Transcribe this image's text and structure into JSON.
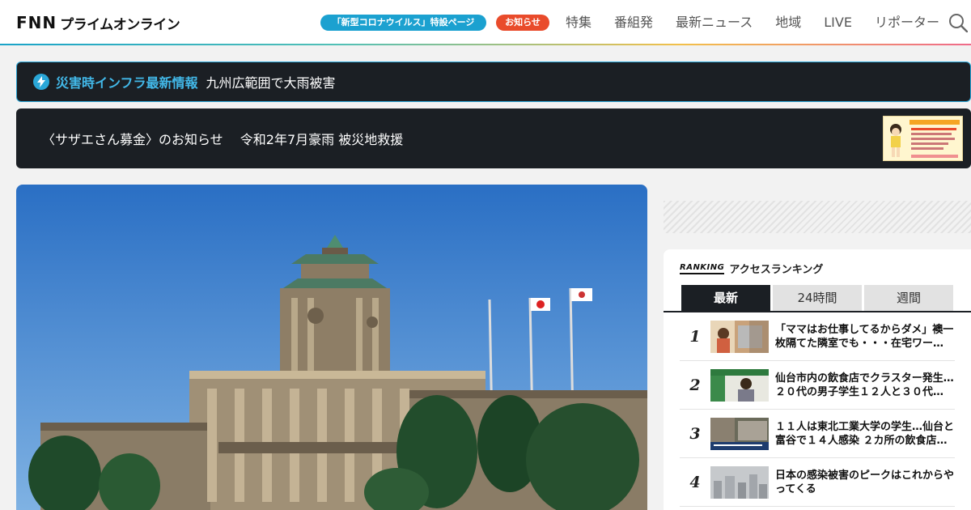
{
  "header": {
    "logo_main": "FNN",
    "logo_sub": "プライムオンライン",
    "corona_pill": "「新型コロナウイルス」特設ページ",
    "news_pill": "お知らせ",
    "nav": [
      "特集",
      "番組発",
      "最新ニュース",
      "地域",
      "LIVE",
      "リポーター"
    ],
    "search_icon": "search-icon"
  },
  "alert": {
    "icon": "lightning-icon",
    "title": "災害時インフラ最新情報",
    "text": "九州広範囲で大雨被害"
  },
  "banner": {
    "text": "〈サザエさん募金〉のお知らせ　 令和2年7月豪雨 被災地救援"
  },
  "ranking": {
    "label_en": "RANKING",
    "label_ja": "アクセスランキング",
    "tabs": [
      "最新",
      "24時間",
      "週間"
    ],
    "active_tab": 0,
    "items": [
      {
        "rank": "1",
        "title": "「ママはお仕事してるからダメ」襖一枚隔てた隣室でも・・・在宅ワー…"
      },
      {
        "rank": "2",
        "title": "仙台市内の飲食店でクラスター発生…２０代の男子学生１２人と３０代…"
      },
      {
        "rank": "3",
        "title": "１１人は東北工業大学の学生…仙台と富谷で１４人感染 ２カ所の飲食店…"
      },
      {
        "rank": "4",
        "title": "日本の感染被害のピークはこれからやってくる"
      }
    ]
  },
  "colors": {
    "accent": "#1ba1d0",
    "alert_blue": "#42b8e8",
    "news_red": "#e94b2b",
    "dark_panel": "#1b1f24"
  }
}
